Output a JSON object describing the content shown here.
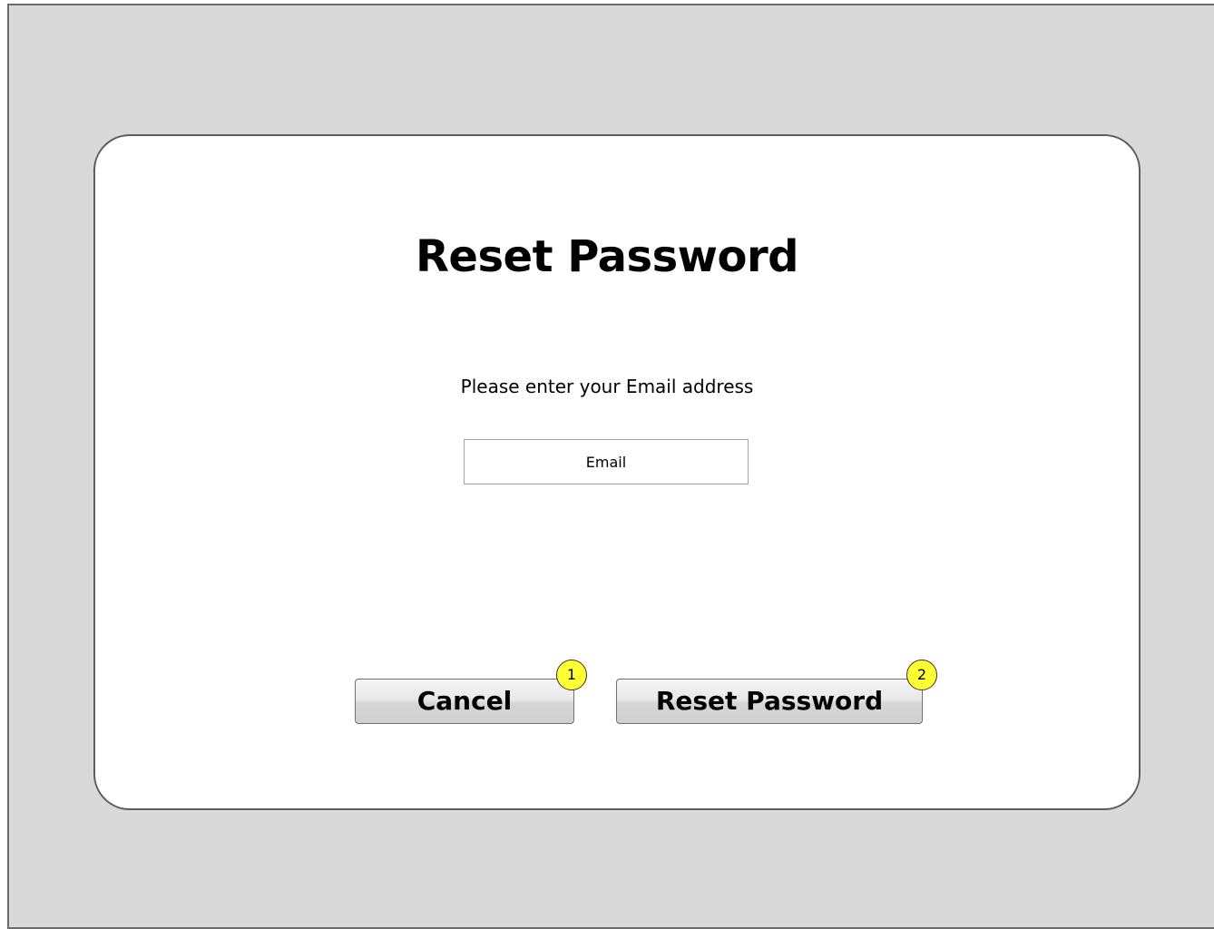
{
  "dialog": {
    "title": "Reset Password",
    "prompt": "Please enter your Email address",
    "email_field": {
      "placeholder": "Email",
      "value": ""
    },
    "buttons": {
      "cancel_label": "Cancel",
      "reset_label": "Reset Password"
    }
  },
  "annotations": {
    "badge_1": "1",
    "badge_2": "2"
  },
  "colors": {
    "screen_background": "#d9d9d9",
    "dialog_background": "#ffffff",
    "badge_fill": "#ffff33"
  }
}
